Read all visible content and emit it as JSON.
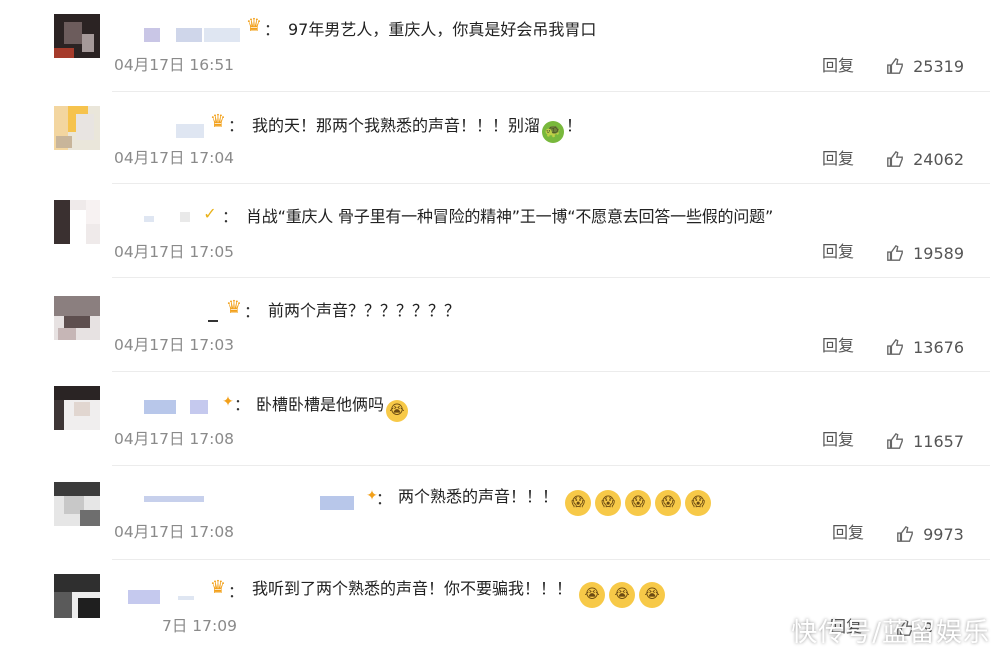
{
  "comments": [
    {
      "text": "97年男艺人，重庆人，你真是好会吊我胃口",
      "time": "04月17日 16:51",
      "reply": "回复",
      "likes": "25319",
      "emoji_count": 0
    },
    {
      "text": "我的天！那两个我熟悉的声音！！！别溜",
      "text_tail": "！",
      "time": "04月17日 17:04",
      "reply": "回复",
      "likes": "24062",
      "emoji": "turtle-emoji"
    },
    {
      "text": "肖战“重庆人 骨子里有一种冒险的精神”王一博“不愿意去回答一些假的问题”",
      "time": "04月17日 17:05",
      "reply": "回复",
      "likes": "19589"
    },
    {
      "text": "前两个声音？？？？？？？",
      "time": "04月17日 17:03",
      "reply": "回复",
      "likes": "13676"
    },
    {
      "text": "卧槽卧槽是他俩吗",
      "time": "04月17日 17:08",
      "reply": "回复",
      "likes": "11657",
      "emoji": "crying-emoji"
    },
    {
      "text": "两个熟悉的声音！！！",
      "time": "04月17日 17:08",
      "reply": "回复",
      "likes": "9973",
      "emoji": "scared-emoji"
    },
    {
      "text": "我听到了两个熟悉的声音！你不要骗我！！！",
      "time": "7日 17:09",
      "reply": "回复",
      "likes": "9"
    }
  ],
  "colon": "：",
  "watermark": "快传号/蓝留娱乐",
  "colors": {
    "background": "#ffffff",
    "time": "#8a8a8a",
    "crown": "#f2a01a"
  }
}
